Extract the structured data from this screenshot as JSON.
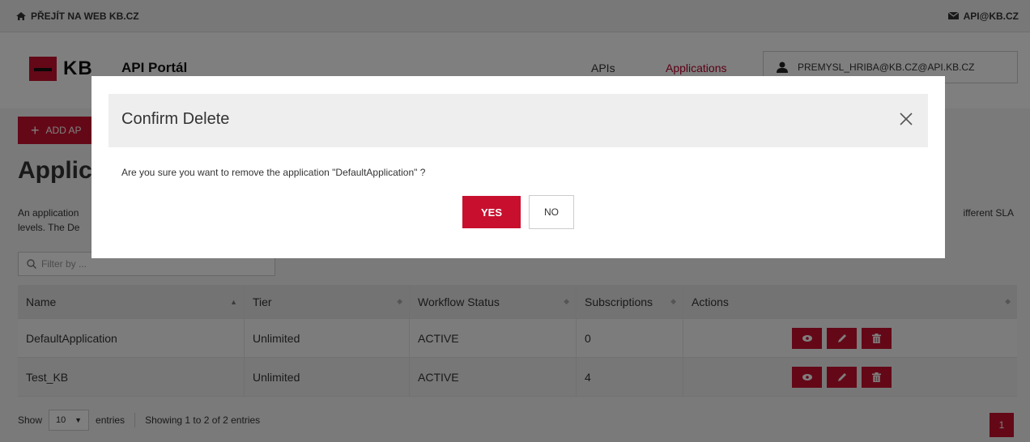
{
  "topbar": {
    "web_link": "PŘEJÍT NA WEB KB.CZ",
    "email_link": "API@KB.CZ"
  },
  "header": {
    "logo_text": "KB",
    "portal_title": "API Portál",
    "nav": {
      "apis": "APIs",
      "applications": "Applications"
    },
    "user": "PREMYSL_HRIBA@KB.CZ@API.KB.CZ"
  },
  "main": {
    "add_button": "ADD AP",
    "title": "Applic",
    "description_line1": "An application",
    "description_line1_end": "ifferent SLA",
    "description_line2": "levels. The De",
    "filter_placeholder": "Filter by ..."
  },
  "table": {
    "columns": [
      "Name",
      "Tier",
      "Workflow Status",
      "Subscriptions",
      "Actions"
    ],
    "rows": [
      {
        "name": "DefaultApplication",
        "tier": "Unlimited",
        "status": "ACTIVE",
        "subscriptions": "0"
      },
      {
        "name": "Test_KB",
        "tier": "Unlimited",
        "status": "ACTIVE",
        "subscriptions": "4"
      }
    ]
  },
  "footer": {
    "show_label": "Show",
    "entries_value": "10",
    "entries_label": "entries",
    "showing_text": "Showing 1 to 2 of 2 entries",
    "page_number": "1"
  },
  "modal": {
    "title": "Confirm Delete",
    "message": "Are you sure you want to remove the application \"DefaultApplication\" ?",
    "yes_label": "YES",
    "no_label": "NO"
  },
  "colors": {
    "accent": "#c8102e",
    "nav_active": "#b8002b"
  },
  "icons": [
    "home-icon",
    "mail-icon",
    "user-icon",
    "search-icon",
    "sort-icon",
    "eye-icon",
    "pencil-icon",
    "trash-icon",
    "close-icon",
    "chevron-down-icon"
  ]
}
